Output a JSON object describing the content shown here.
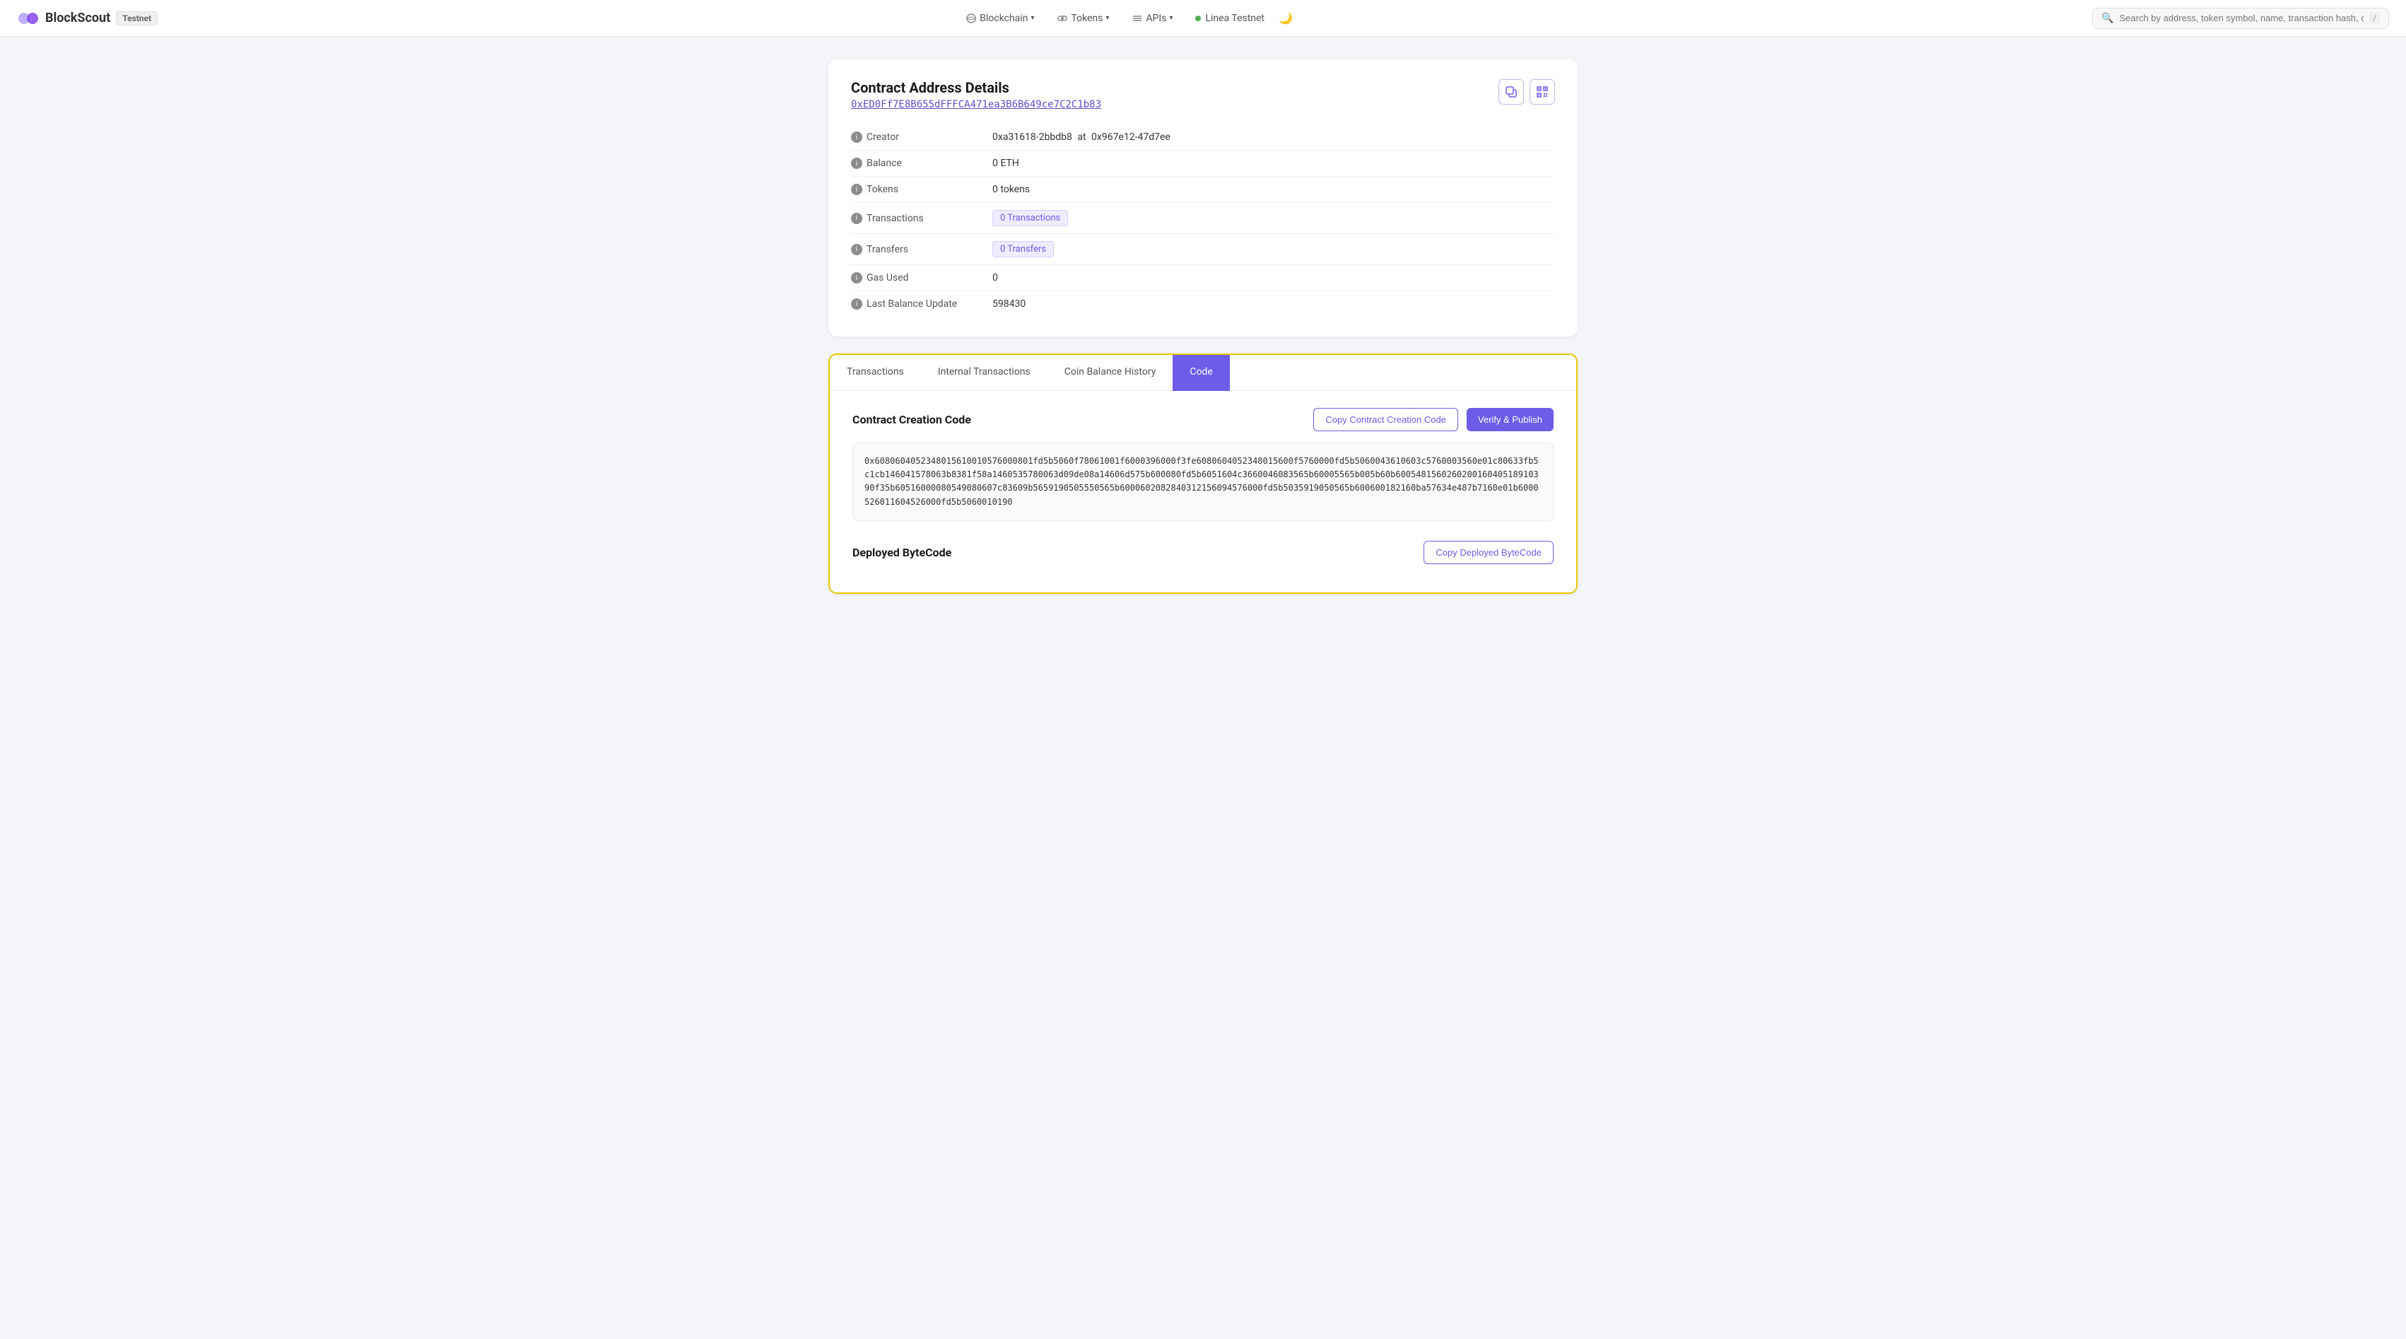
{
  "brand": {
    "name": "BlockScout",
    "testnet_label": "Testnet"
  },
  "navbar": {
    "blockchain_label": "Blockchain",
    "tokens_label": "Tokens",
    "apis_label": "APIs",
    "network_label": "Linea Testnet",
    "search_placeholder": "Search by address, token symbol, name, transaction hash, or block number",
    "kbd_hint": "/"
  },
  "contract_details": {
    "card_title": "Contract Address Details",
    "address": "0xED0Ff7E8B655dFFFCA471ea3B6B649ce7C2C1b83",
    "creator_label": "Creator",
    "creator_address": "0xa31618-2bbdb8",
    "creator_tx": "0x967e12-47d7ee",
    "balance_label": "Balance",
    "balance_value": "0 ETH",
    "tokens_label": "Tokens",
    "tokens_value": "0 tokens",
    "transactions_label": "Transactions",
    "transactions_badge": "0 Transactions",
    "transfers_label": "Transfers",
    "transfers_badge": "0 Transfers",
    "gas_used_label": "Gas Used",
    "gas_used_value": "0",
    "last_balance_label": "Last Balance Update",
    "last_balance_value": "598430"
  },
  "tabs": {
    "transactions": "Transactions",
    "internal_transactions": "Internal Transactions",
    "coin_balance_history": "Coin Balance History",
    "code": "Code"
  },
  "code_section": {
    "creation_code_title": "Contract Creation Code",
    "copy_creation_btn": "Copy Contract Creation Code",
    "verify_btn": "Verify & Publish",
    "creation_code": "0x6080604052348015610010576000801fd5b5060f78061001f6000396000f3fe6080604052348015600f5760000fd5b5060043610603c5760003560e01c80633fb5c1cb146041578063b8381f58a1460535780063d09de08a14606d575b600080fd5b6051604c3660046083565b60005565b005b60b600548156026020016040518910390f35b60516000080549080607c83609b5659190505550565b6000602082840312156094576000fd5b5035919050565b600600182160ba57634e487b7160e01b6000526011604526000fd5b5060010190",
    "deployed_bytecode_title": "Deployed ByteCode",
    "copy_deployed_btn": "Copy Deployed ByteCode"
  }
}
